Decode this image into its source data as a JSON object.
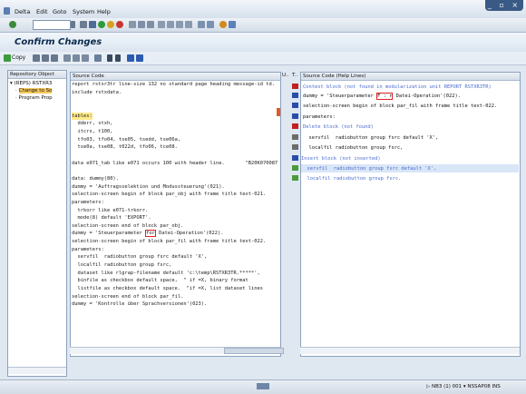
{
  "menu": {
    "items": [
      "Delta",
      "Edit",
      "Goto",
      "System",
      "Help"
    ]
  },
  "window": {
    "title": "Confirm Changes",
    "controls": "_ ▫ ×"
  },
  "toolbar": {
    "copy_label": "Copy"
  },
  "repository": {
    "header": "Repository Object",
    "items": [
      "(REPS) RSTXR3",
      "Change to So",
      "Program Prop"
    ]
  },
  "source": {
    "header": "Source Code",
    "lines": [
      "report rstxr3tr line-size 132 no standard page heading message-id td.",
      "include rstxdata.",
      "",
      "",
      "tables:",
      "  dderr, stxh,",
      "  itcrs, t100,",
      "  tfo03, tfo04, tse05, tsedd, tse06a,",
      "  tse0a, tse08, t022d, tfo06, tce08.",
      "",
      "data e071_tab like e071 occurs 100 with header line.       \"B20K070087",
      "",
      "data: dummy(80).",
      "dummy = 'Auftragsselektion und Modussteuerung'(021).",
      "selection-screen begin of block par_obj with frame title text-021.",
      "parameters:",
      "  trkorr like e071-trkorr.",
      "  mode(8) default 'EXPORT'.",
      "selection-screen end of block par_obj.",
      "dummy = 'Steuerparameter for Datei-Operation'(022).",
      "selection-screen begin of block par_fil with frame title text-022.",
      "parameters:",
      "  servfil  radiobutton group fsrc default 'X',",
      "  localfil radiobutton group fsrc,",
      "  dataset like rlgrap-filename default 'c:\\temp\\RSTXR3TR.*****',",
      "  binfile as checkbox default space,  \" if =X, binary format",
      "  listfile as checkbox default space.  \"if =X, list dataset lines",
      "selection-screen end of block par_fil.",
      "dummy = 'Kontrolle über Sprachversionen'(023)."
    ]
  },
  "columns": {
    "u": "U..",
    "t": "T.."
  },
  "help": {
    "header": "Source Code (Help Lines)",
    "lines": [
      "Context block (not found in modularization unit REPORT RSTXR3TR)",
      "dummy = 'Steuerparameter F : r Datei-Operation'(022).",
      "selection-screen begin of block par_fil with frame title text-022.",
      "parameters:",
      "Delete block (not found)",
      "  servfil  radiobutton group fsrc default 'X',",
      "  localfil radiobutton group fsrc,",
      "Insert block (not inserted)",
      "  servfil  radiobutton group fsrc default 'X',",
      "  localfil radiobutton group fsrc."
    ],
    "colors": [
      "#4a6bd0",
      "#111111",
      "#111111",
      "#111111",
      "#4a6bd0",
      "#111111",
      "#111111",
      "#4a6bd0",
      "#4a6bd0",
      "#4a6bd0"
    ]
  },
  "status": {
    "text": "NB3 (1) 001",
    "server": "NSSAP08",
    "mode": "INS"
  }
}
